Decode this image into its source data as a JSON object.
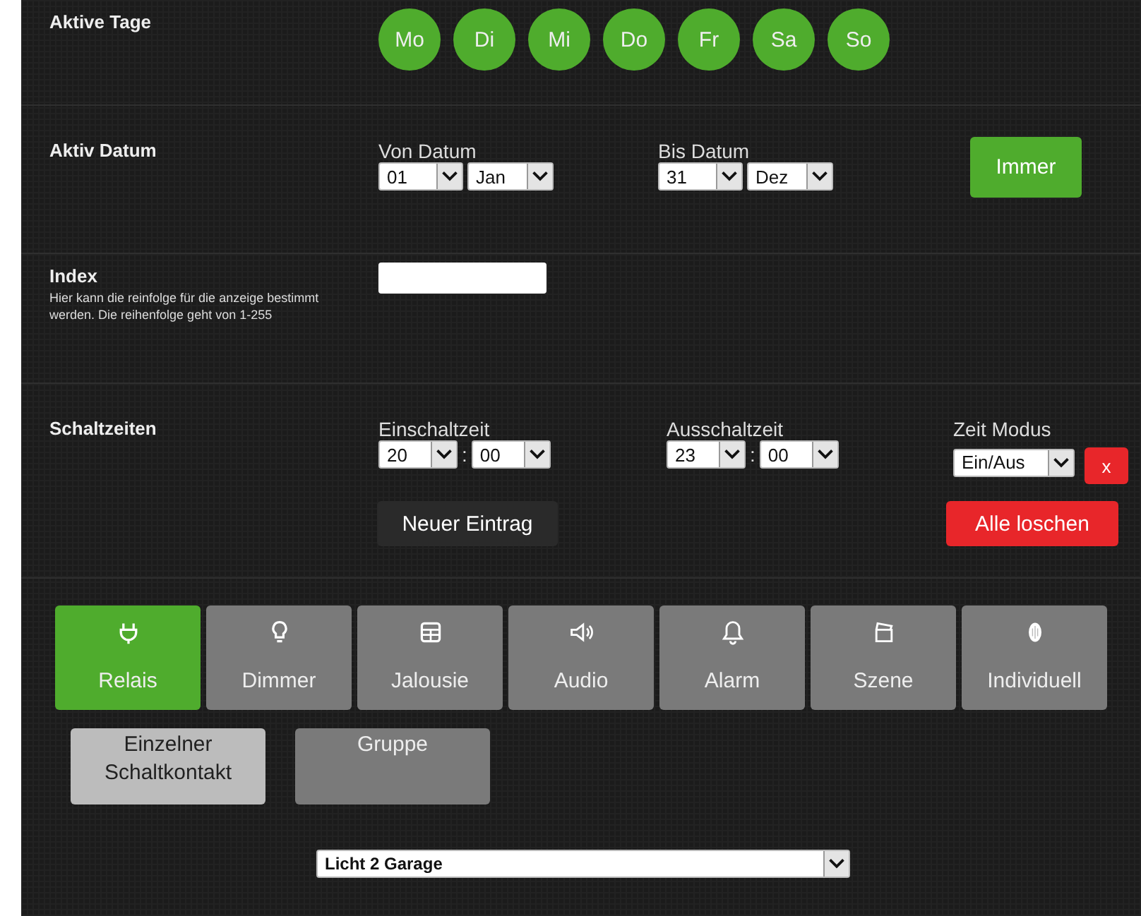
{
  "days": {
    "label": "Aktive Tage",
    "items": [
      {
        "label": "Mo",
        "selected": true
      },
      {
        "label": "Di",
        "selected": true
      },
      {
        "label": "Mi",
        "selected": true
      },
      {
        "label": "Do",
        "selected": true
      },
      {
        "label": "Fr",
        "selected": true
      },
      {
        "label": "Sa",
        "selected": true
      },
      {
        "label": "So",
        "selected": true
      }
    ]
  },
  "date_range": {
    "label": "Aktiv Datum",
    "from": {
      "label": "Von Datum",
      "day": "01",
      "month": "Jan"
    },
    "to": {
      "label": "Bis Datum",
      "day": "31",
      "month": "Dez"
    },
    "button": "Immer"
  },
  "index": {
    "label": "Index",
    "description": "Hier kann die reinfolge für die anzeige bestimmt werden. Die reihenfolge geht von 1-255"
  },
  "schedule": {
    "label": "Schaltzeiten",
    "on_time": {
      "label": "Einschaltzeit",
      "hour": "20",
      "separator": ":",
      "minute": "00"
    },
    "off_time": {
      "label": "Ausschaltzeit",
      "hour": "23",
      "separator": ":",
      "minute": "00"
    },
    "mode": {
      "label": "Zeit Modus",
      "value": "Ein/Aus"
    },
    "delete_button": "x",
    "new_button": "Neuer Eintrag",
    "clear_button": "Alle loschen"
  },
  "categories": [
    {
      "label": "Relais",
      "selected": true
    },
    {
      "label": "Dimmer",
      "selected": false
    },
    {
      "label": "Jalousie",
      "selected": false
    },
    {
      "label": "Audio",
      "selected": false
    },
    {
      "label": "Alarm",
      "selected": false
    },
    {
      "label": "Szene",
      "selected": false
    },
    {
      "label": "Individuell",
      "selected": false
    }
  ],
  "subtypes": [
    {
      "label": "Einzelner Schaltkontakt",
      "selected": true
    },
    {
      "label": "Gruppe",
      "selected": false
    }
  ],
  "device_select": {
    "value": "Licht 2 Garage"
  }
}
